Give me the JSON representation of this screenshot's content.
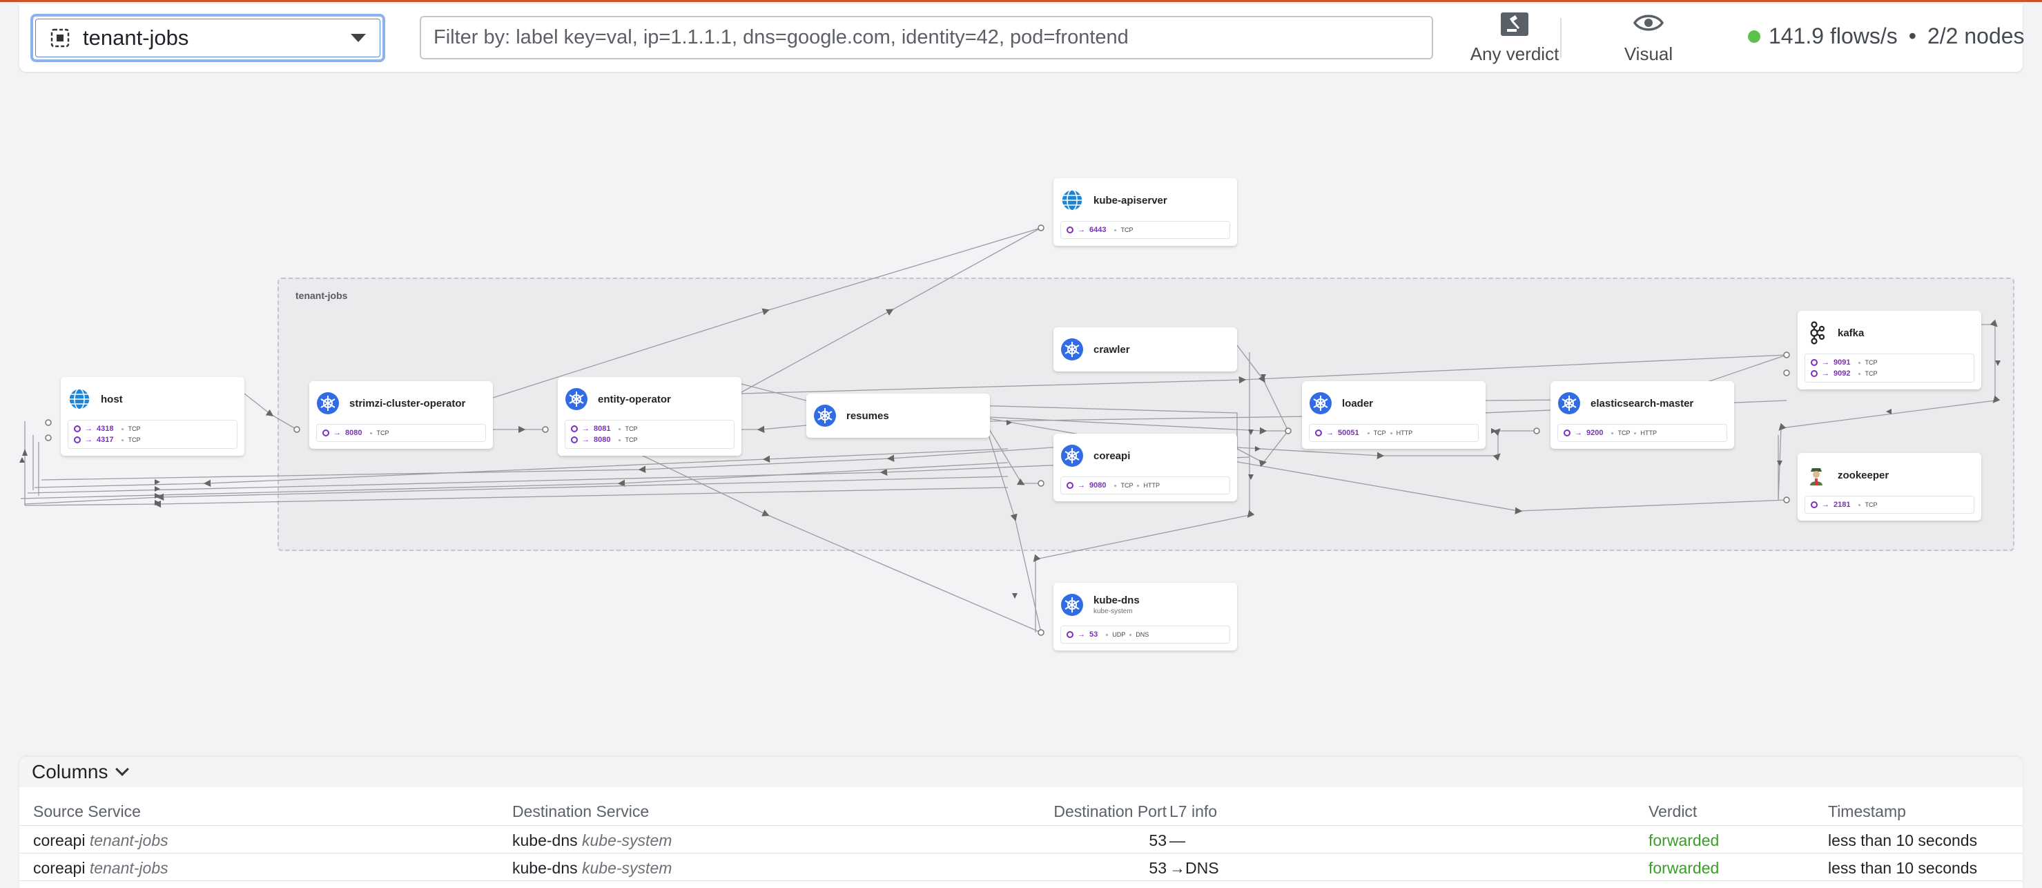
{
  "topbar": {
    "namespace": "tenant-jobs",
    "filter_placeholder": "Filter by: label key=val, ip=1.1.1.1, dns=google.com, identity=42, pod=frontend",
    "verdict_label": "Any verdict",
    "visual_label": "Visual",
    "flows_rate": "141.9 flows/s",
    "separator": "•",
    "nodes": "2/2 nodes"
  },
  "map": {
    "namespace_box_label": "tenant-jobs",
    "cards": {
      "kube_apiserver": {
        "title": "kube-apiserver",
        "ports": [
          {
            "port": "6443",
            "protocols": [
              "TCP"
            ]
          }
        ]
      },
      "host": {
        "title": "host",
        "ports": [
          {
            "port": "4318",
            "protocols": [
              "TCP"
            ]
          },
          {
            "port": "4317",
            "protocols": [
              "TCP"
            ]
          }
        ]
      },
      "strimzi": {
        "title": "strimzi-cluster-operator",
        "ports": [
          {
            "port": "8080",
            "protocols": [
              "TCP"
            ]
          }
        ]
      },
      "entity_operator": {
        "title": "entity-operator",
        "ports": [
          {
            "port": "8081",
            "protocols": [
              "TCP"
            ]
          },
          {
            "port": "8080",
            "protocols": [
              "TCP"
            ]
          }
        ]
      },
      "resumes": {
        "title": "resumes",
        "ports": []
      },
      "crawler": {
        "title": "crawler",
        "ports": []
      },
      "coreapi": {
        "title": "coreapi",
        "ports": [
          {
            "port": "9080",
            "protocols": [
              "TCP",
              "HTTP"
            ]
          }
        ]
      },
      "loader": {
        "title": "loader",
        "ports": [
          {
            "port": "50051",
            "protocols": [
              "TCP",
              "HTTP"
            ]
          }
        ]
      },
      "elasticsearch": {
        "title": "elasticsearch-master",
        "ports": [
          {
            "port": "9200",
            "protocols": [
              "TCP",
              "HTTP"
            ]
          }
        ]
      },
      "kafka": {
        "title": "kafka",
        "ports": [
          {
            "port": "9091",
            "protocols": [
              "TCP"
            ]
          },
          {
            "port": "9092",
            "protocols": [
              "TCP"
            ]
          }
        ]
      },
      "zookeeper": {
        "title": "zookeeper",
        "ports": [
          {
            "port": "2181",
            "protocols": [
              "TCP"
            ]
          }
        ]
      },
      "kube_dns": {
        "title": "kube-dns",
        "subtitle": "kube-system",
        "ports": [
          {
            "port": "53",
            "protocols": [
              "UDP",
              "DNS"
            ]
          }
        ]
      }
    },
    "port_arrow": "→"
  },
  "flows": {
    "columns_label": "Columns",
    "headers": [
      "Source Service",
      "Destination Service",
      "Destination Port",
      "L7 info",
      "Verdict",
      "Timestamp"
    ],
    "rows": [
      {
        "src": "coreapi",
        "src_ns": "tenant-jobs",
        "dst": "kube-dns",
        "dst_ns": "kube-system",
        "port": "53",
        "l7": "—",
        "verdict": "forwarded",
        "ts": "less than 10 seconds"
      },
      {
        "src": "coreapi",
        "src_ns": "tenant-jobs",
        "dst": "kube-dns",
        "dst_ns": "kube-system",
        "port": "53",
        "l7": "→DNS",
        "verdict": "forwarded",
        "ts": "less than 10 seconds"
      }
    ]
  },
  "colors": {
    "accent": "#c9542b",
    "port": "#7b2fbe",
    "k8s": "#326ce5",
    "forwarded": "#3b9d2a",
    "status_ok": "#5cc14a"
  }
}
